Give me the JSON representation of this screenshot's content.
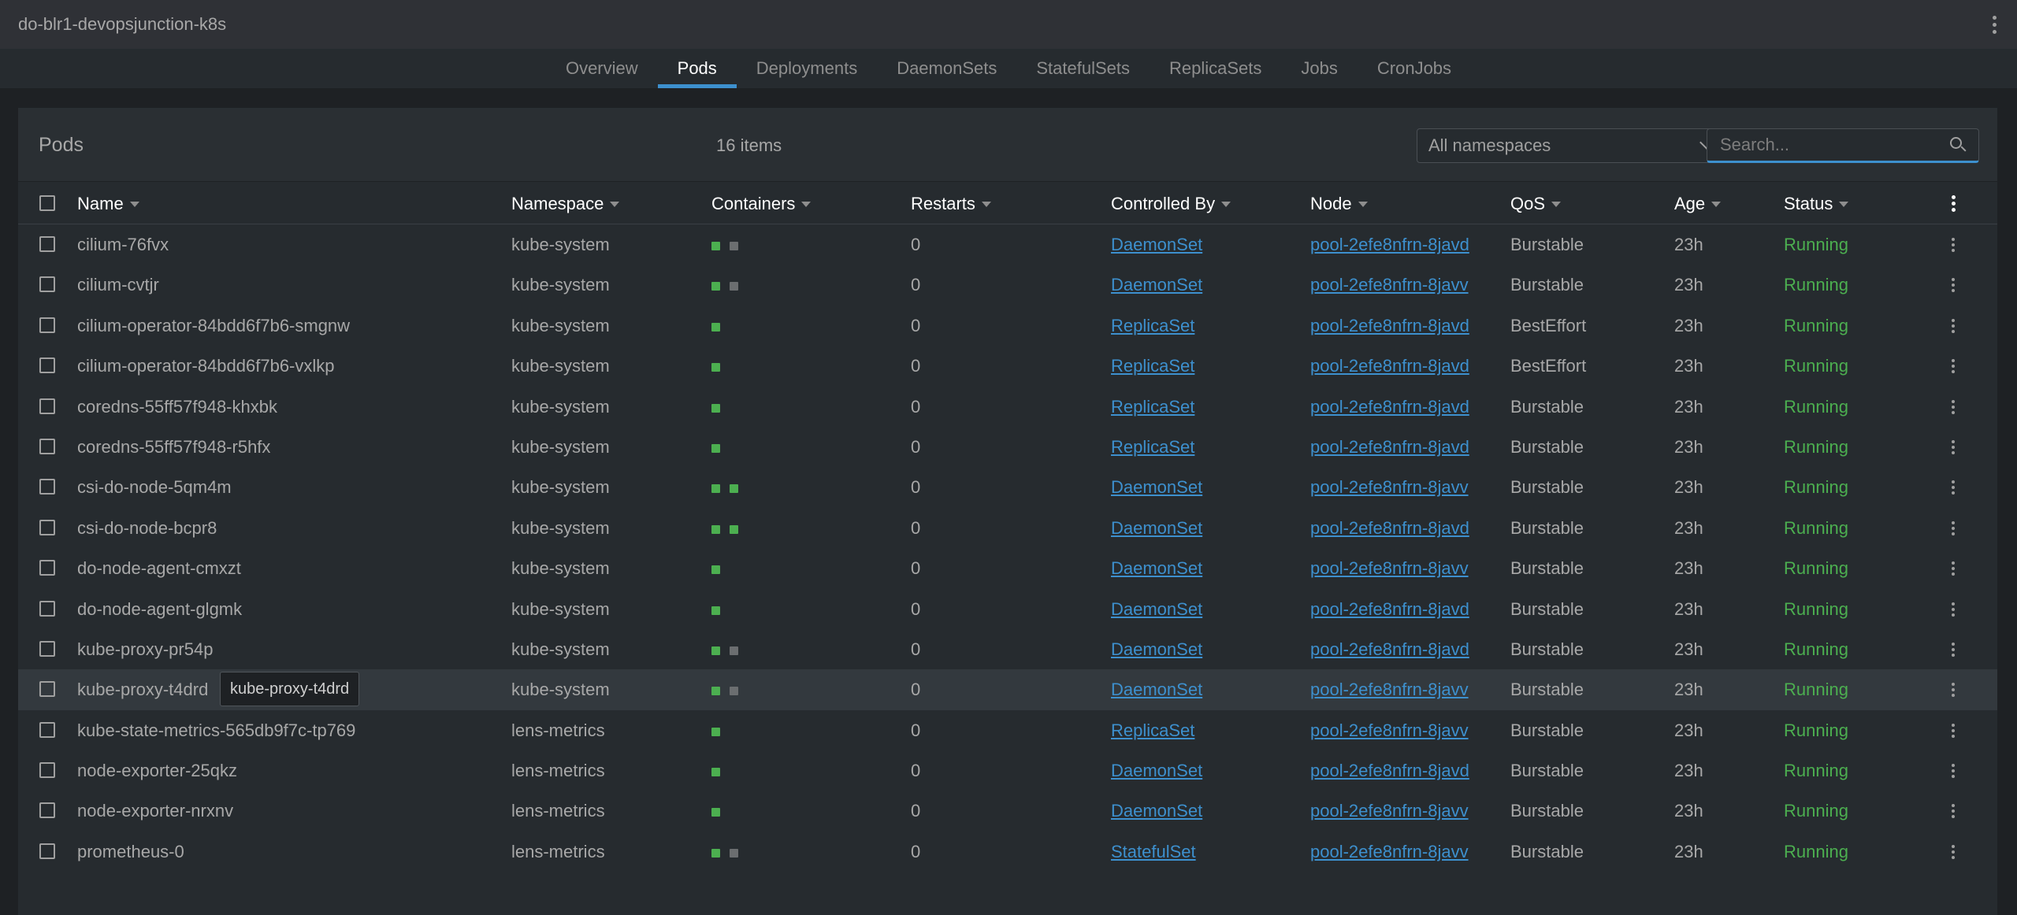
{
  "titlebar": {
    "cluster": "do-blr1-devopsjunction-k8s",
    "menu_icon": "more-vertical-icon"
  },
  "tabs": [
    {
      "label": "Overview",
      "active": false
    },
    {
      "label": "Pods",
      "active": true
    },
    {
      "label": "Deployments",
      "active": false
    },
    {
      "label": "DaemonSets",
      "active": false
    },
    {
      "label": "StatefulSets",
      "active": false
    },
    {
      "label": "ReplicaSets",
      "active": false
    },
    {
      "label": "Jobs",
      "active": false
    },
    {
      "label": "CronJobs",
      "active": false
    }
  ],
  "panel": {
    "title": "Pods",
    "count": "16 items",
    "namespace_select": "All namespaces",
    "search_placeholder": "Search..."
  },
  "columns": {
    "name": "Name",
    "namespace": "Namespace",
    "containers": "Containers",
    "restarts": "Restarts",
    "controlled_by": "Controlled By",
    "node": "Node",
    "qos": "QoS",
    "age": "Age",
    "status": "Status"
  },
  "colors": {
    "container_ok": "#4caf50",
    "container_idle": "#6b6e70",
    "accent": "#3d90ce",
    "running": "#4caf50"
  },
  "rows": [
    {
      "name": "cilium-76fvx",
      "namespace": "kube-system",
      "containers": [
        "ok",
        "idle"
      ],
      "restarts": "0",
      "controlled_by": "DaemonSet",
      "node": "pool-2efe8nfrn-8javd",
      "qos": "Burstable",
      "age": "23h",
      "status": "Running"
    },
    {
      "name": "cilium-cvtjr",
      "namespace": "kube-system",
      "containers": [
        "ok",
        "idle"
      ],
      "restarts": "0",
      "controlled_by": "DaemonSet",
      "node": "pool-2efe8nfrn-8javv",
      "qos": "Burstable",
      "age": "23h",
      "status": "Running"
    },
    {
      "name": "cilium-operator-84bdd6f7b6-smgnw",
      "namespace": "kube-system",
      "containers": [
        "ok"
      ],
      "restarts": "0",
      "controlled_by": "ReplicaSet",
      "node": "pool-2efe8nfrn-8javd",
      "qos": "BestEffort",
      "age": "23h",
      "status": "Running"
    },
    {
      "name": "cilium-operator-84bdd6f7b6-vxlkp",
      "namespace": "kube-system",
      "containers": [
        "ok"
      ],
      "restarts": "0",
      "controlled_by": "ReplicaSet",
      "node": "pool-2efe8nfrn-8javd",
      "qos": "BestEffort",
      "age": "23h",
      "status": "Running"
    },
    {
      "name": "coredns-55ff57f948-khxbk",
      "namespace": "kube-system",
      "containers": [
        "ok"
      ],
      "restarts": "0",
      "controlled_by": "ReplicaSet",
      "node": "pool-2efe8nfrn-8javd",
      "qos": "Burstable",
      "age": "23h",
      "status": "Running"
    },
    {
      "name": "coredns-55ff57f948-r5hfx",
      "namespace": "kube-system",
      "containers": [
        "ok"
      ],
      "restarts": "0",
      "controlled_by": "ReplicaSet",
      "node": "pool-2efe8nfrn-8javd",
      "qos": "Burstable",
      "age": "23h",
      "status": "Running"
    },
    {
      "name": "csi-do-node-5qm4m",
      "namespace": "kube-system",
      "containers": [
        "ok",
        "ok"
      ],
      "restarts": "0",
      "controlled_by": "DaemonSet",
      "node": "pool-2efe8nfrn-8javv",
      "qos": "Burstable",
      "age": "23h",
      "status": "Running"
    },
    {
      "name": "csi-do-node-bcpr8",
      "namespace": "kube-system",
      "containers": [
        "ok",
        "ok"
      ],
      "restarts": "0",
      "controlled_by": "DaemonSet",
      "node": "pool-2efe8nfrn-8javd",
      "qos": "Burstable",
      "age": "23h",
      "status": "Running"
    },
    {
      "name": "do-node-agent-cmxzt",
      "namespace": "kube-system",
      "containers": [
        "ok"
      ],
      "restarts": "0",
      "controlled_by": "DaemonSet",
      "node": "pool-2efe8nfrn-8javv",
      "qos": "Burstable",
      "age": "23h",
      "status": "Running"
    },
    {
      "name": "do-node-agent-glgmk",
      "namespace": "kube-system",
      "containers": [
        "ok"
      ],
      "restarts": "0",
      "controlled_by": "DaemonSet",
      "node": "pool-2efe8nfrn-8javd",
      "qos": "Burstable",
      "age": "23h",
      "status": "Running"
    },
    {
      "name": "kube-proxy-pr54p",
      "namespace": "kube-system",
      "containers": [
        "ok",
        "idle"
      ],
      "restarts": "0",
      "controlled_by": "DaemonSet",
      "node": "pool-2efe8nfrn-8javd",
      "qos": "Burstable",
      "age": "23h",
      "status": "Running"
    },
    {
      "name": "kube-proxy-t4drd",
      "namespace": "kube-system",
      "containers": [
        "ok",
        "idle"
      ],
      "restarts": "0",
      "controlled_by": "DaemonSet",
      "node": "pool-2efe8nfrn-8javv",
      "qos": "Burstable",
      "age": "23h",
      "status": "Running",
      "hover": true,
      "tooltip": "kube-proxy-t4drd"
    },
    {
      "name": "kube-state-metrics-565db9f7c-tp769",
      "namespace": "lens-metrics",
      "containers": [
        "ok"
      ],
      "restarts": "0",
      "controlled_by": "ReplicaSet",
      "node": "pool-2efe8nfrn-8javv",
      "qos": "Burstable",
      "age": "23h",
      "status": "Running"
    },
    {
      "name": "node-exporter-25qkz",
      "namespace": "lens-metrics",
      "containers": [
        "ok"
      ],
      "restarts": "0",
      "controlled_by": "DaemonSet",
      "node": "pool-2efe8nfrn-8javd",
      "qos": "Burstable",
      "age": "23h",
      "status": "Running"
    },
    {
      "name": "node-exporter-nrxnv",
      "namespace": "lens-metrics",
      "containers": [
        "ok"
      ],
      "restarts": "0",
      "controlled_by": "DaemonSet",
      "node": "pool-2efe8nfrn-8javv",
      "qos": "Burstable",
      "age": "23h",
      "status": "Running"
    },
    {
      "name": "prometheus-0",
      "namespace": "lens-metrics",
      "containers": [
        "ok",
        "idle"
      ],
      "restarts": "0",
      "controlled_by": "StatefulSet",
      "node": "pool-2efe8nfrn-8javv",
      "qos": "Burstable",
      "age": "23h",
      "status": "Running"
    }
  ]
}
